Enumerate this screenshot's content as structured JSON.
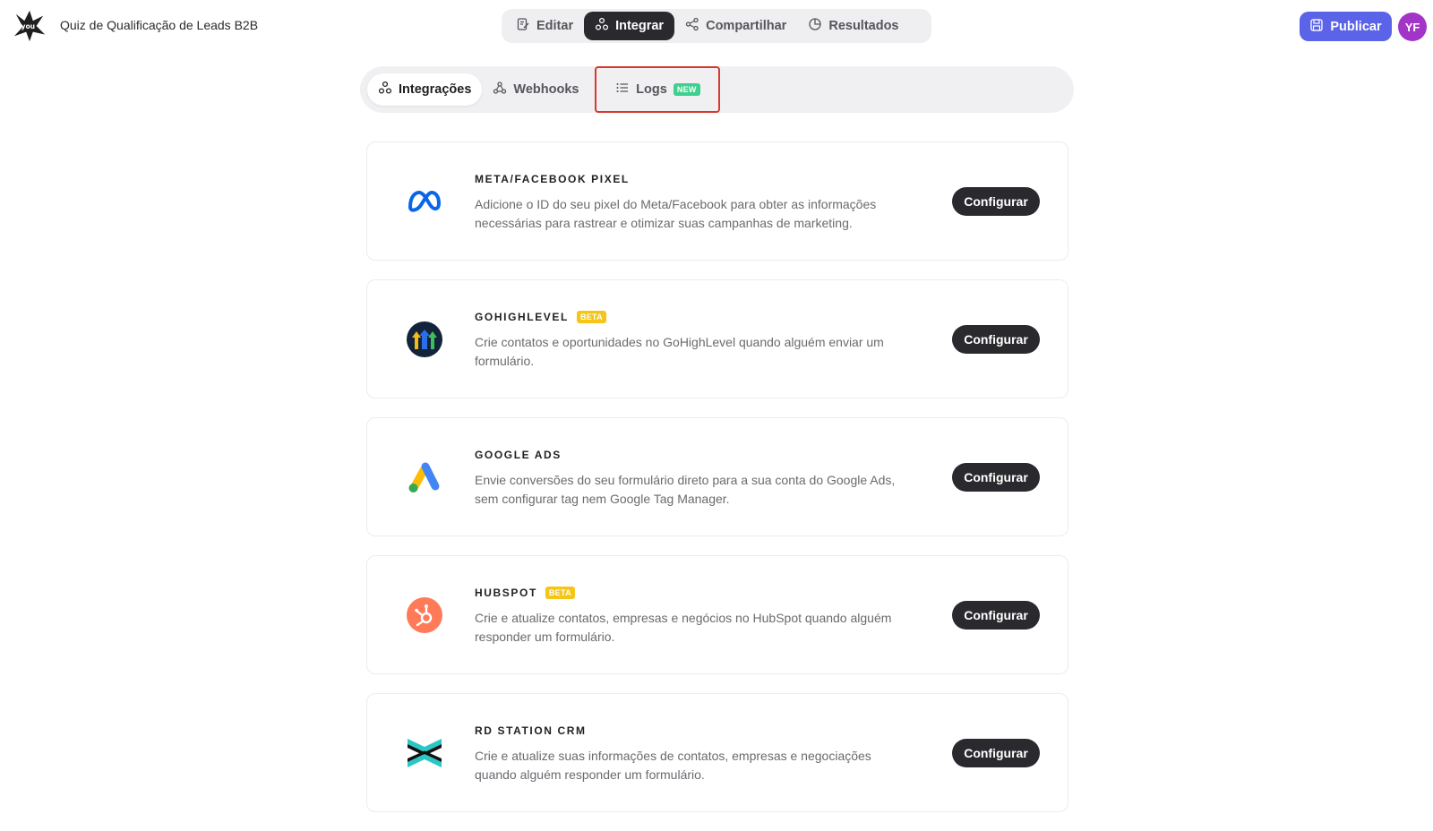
{
  "header": {
    "form_title": "Quiz de Qualificação de Leads B2B",
    "nav": [
      {
        "label": "Editar",
        "icon": "edit-icon"
      },
      {
        "label": "Integrar",
        "icon": "integrations-icon",
        "active": true
      },
      {
        "label": "Compartilhar",
        "icon": "share-icon"
      },
      {
        "label": "Resultados",
        "icon": "chart-pie-icon"
      }
    ],
    "publish_label": "Publicar",
    "avatar_initials": "YF"
  },
  "subtabs": {
    "integrations": "Integrações",
    "webhooks": "Webhooks",
    "logs": "Logs",
    "logs_badge": "NEW"
  },
  "integrations": [
    {
      "name": "META/FACEBOOK PIXEL",
      "icon": "meta-icon",
      "description": "Adicione o ID do seu pixel do Meta/Facebook para obter as informações necessárias para rastrear e otimizar suas campanhas de marketing.",
      "action": "Configurar"
    },
    {
      "name": "GOHIGHLEVEL",
      "badge": "BETA",
      "icon": "gohighlevel-icon",
      "description": "Crie contatos e oportunidades no GoHighLevel quando alguém enviar um formulário.",
      "action": "Configurar"
    },
    {
      "name": "GOOGLE ADS",
      "icon": "google-ads-icon",
      "description": "Envie conversões do seu formulário direto para a sua conta do Google Ads, sem configurar tag nem Google Tag Manager.",
      "action": "Configurar"
    },
    {
      "name": "HUBSPOT",
      "badge": "BETA",
      "icon": "hubspot-icon",
      "description": "Crie e atualize contatos, empresas e negócios no HubSpot quando alguém responder um formulário.",
      "action": "Configurar"
    },
    {
      "name": "RD STATION CRM",
      "icon": "rd-station-icon",
      "description": "Crie e atualize suas informações de contatos, empresas e negociações quando alguém responder um formulário.",
      "action": "Configurar"
    }
  ],
  "colors": {
    "accent": "#5b63e8",
    "avatar": "#a234c7",
    "highlight_border": "#d9382b",
    "new_badge": "#3fcf8e",
    "beta_badge": "#f5c518"
  }
}
